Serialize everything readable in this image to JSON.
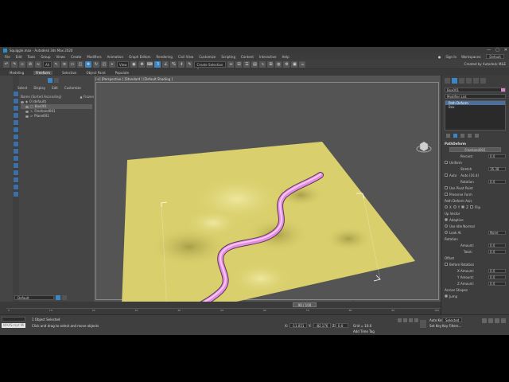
{
  "titlebar": {
    "title": "Squiggle.max - Autodesk 3ds Max 2020",
    "win_controls": [
      "—",
      "▢",
      "✕"
    ]
  },
  "menubar": {
    "items": [
      "File",
      "Edit",
      "Tools",
      "Group",
      "Views",
      "Create",
      "Modifiers",
      "Animation",
      "Graph Editors",
      "Rendering",
      "Civil View",
      "Customize",
      "Scripting",
      "Content",
      "Interactive",
      "Help"
    ],
    "sign_in": "Sign In",
    "workspaces_label": "Workspaces:",
    "workspace_value": "Default"
  },
  "toolbar": {
    "filter_value": "All",
    "view_value": "View",
    "selection_set_placeholder": "Create Selection Se",
    "created_by": "Created by Autodesk M&E"
  },
  "ribbon": {
    "tabs": [
      "Modeling",
      "Freeform",
      "Selection",
      "Object Paint",
      "Populate"
    ],
    "active": "Freeform"
  },
  "explorer": {
    "tabs": [
      "Select",
      "Display",
      "Edit",
      "Customize"
    ],
    "col_name": "Name (Sorted Ascending)",
    "col_frozen": "▲ Frozen",
    "items": [
      {
        "label": "0 (default)"
      },
      {
        "label": "Box001"
      },
      {
        "label": "Freehand001"
      },
      {
        "label": "Plane001"
      }
    ],
    "layer_label": "Default"
  },
  "viewport": {
    "label": "[+] [Perspective ] [Standard ] [Default Shading ]",
    "plane_color": "#d9cf6c",
    "snake_color": "#e58ee0"
  },
  "cmdpanel": {
    "object_name": "Box001",
    "object_color": "#d58acb",
    "modifier_list": "Modifier List",
    "stack": [
      "Path Deform",
      "Box"
    ],
    "section_title": "PathDeform",
    "path_button": "Freehand001",
    "percent_label": "Percent",
    "percent_value": "0.0",
    "uniform_label": "Uniform",
    "stretch_label": "Stretch",
    "stretch_value": "16.38",
    "auto_label": "Auto",
    "auto_value": "Auto (16.4)",
    "rotation_label": "Rotation",
    "rotation_value": "0.0",
    "pivot_label": "Use Pivot Point",
    "preserve_label": "Preserve Form",
    "axis_label": "Path Deform Axis",
    "axis_x": "X",
    "axis_y": "Y",
    "axis_z": "Z",
    "flip_label": "Flip",
    "upvector_label": "Up Vector",
    "adaptive_label": "Adaptive",
    "idlemode_label": "Use Idle Normal",
    "lookat_label": "Look At",
    "none_value": "None",
    "rot_section": "Rotation",
    "amount_label": "Amount:",
    "amount_value": "0.0",
    "twist_label": "Twist:",
    "twist_value": "0.0",
    "offset_section": "Offset",
    "before_rot_label": "Before Rotation",
    "xamount_label": "X Amount:",
    "xamount_value": "0.0",
    "yamount_label": "Y Amount:",
    "yamount_value": "0.0",
    "zamount_label": "Z Amount:",
    "zamount_value": "0.0",
    "across_label": "Across Shapes",
    "jump_label": "Jump"
  },
  "timeline": {
    "slider": "90 / 100",
    "ticks": [
      "0",
      "10",
      "20",
      "30",
      "40",
      "50",
      "60",
      "70",
      "80",
      "90",
      "100"
    ]
  },
  "status": {
    "maxscript_placeholder": "MAXScript Mi",
    "selected": "1 Object Selected",
    "prompt": "Click and drag to select and move objects",
    "x_label": "X:",
    "x_value": "-11.051",
    "y_label": "Y:",
    "y_value": "-82.176",
    "z_label": "Z:",
    "z_value": "0.0",
    "grid": "Grid = 10.0",
    "add_time_tag": "Add Time Tag",
    "autokey": "Auto Key",
    "selected_dd": "Selected",
    "setkey": "Set Key",
    "key_filters": "Key Filters..."
  }
}
